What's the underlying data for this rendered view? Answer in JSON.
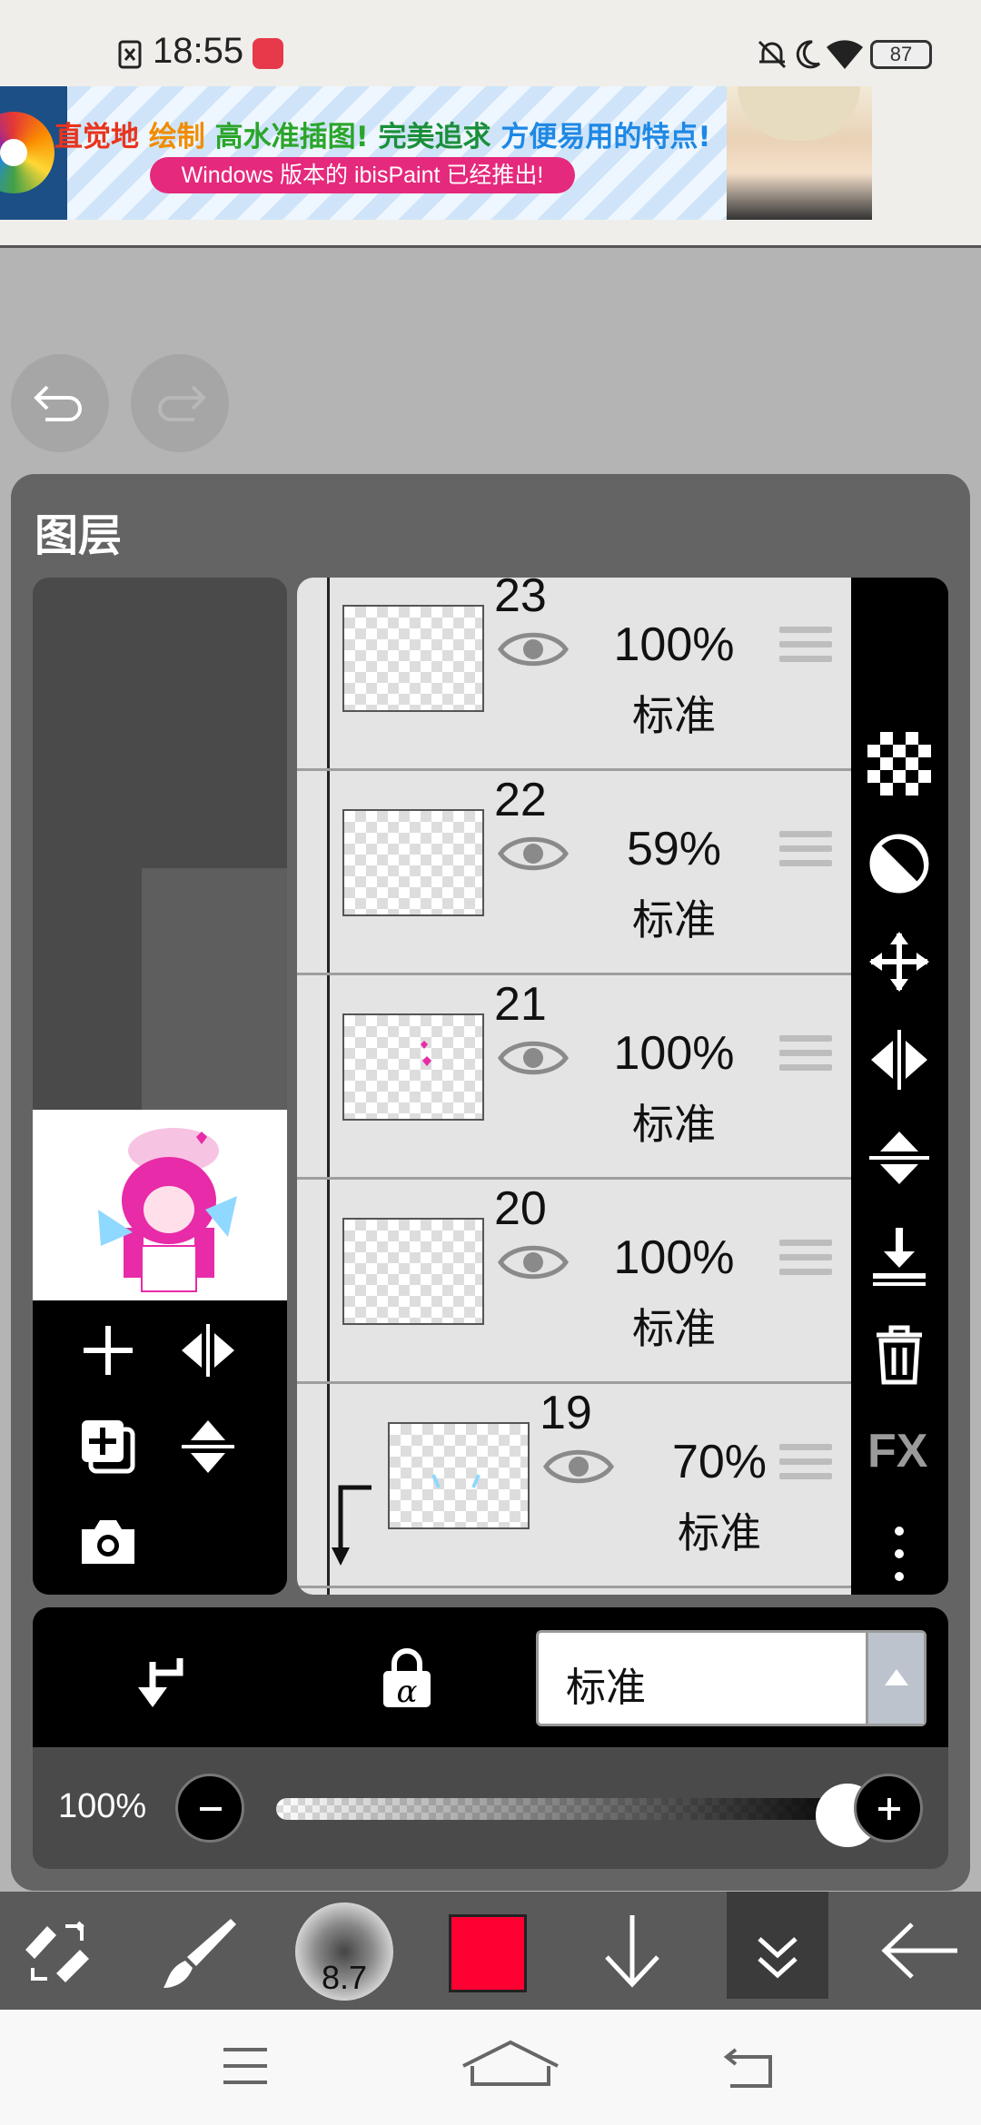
{
  "status_bar": {
    "time": "18:55",
    "battery": "87"
  },
  "ad": {
    "headline_parts": [
      {
        "text": "直觉地 ",
        "color": "#e8341c"
      },
      {
        "text": "绘制 ",
        "color": "#f08c00"
      },
      {
        "text": "高水准插图! ",
        "color": "#2aa52a"
      },
      {
        "text": "完美追求 ",
        "color": "#1a8f3a"
      },
      {
        "text": "方便易用的特点!",
        "color": "#1e88e5"
      }
    ],
    "button": "Windows 版本的 ibisPaint 已经推出!"
  },
  "panel": {
    "title": "图层"
  },
  "layers": [
    {
      "number": "23",
      "opacity": "100%",
      "blend": "标准"
    },
    {
      "number": "22",
      "opacity": "59%",
      "blend": "标准"
    },
    {
      "number": "21",
      "opacity": "100%",
      "blend": "标准"
    },
    {
      "number": "20",
      "opacity": "100%",
      "blend": "标准"
    },
    {
      "number": "19",
      "opacity": "70%",
      "blend": "标准"
    }
  ],
  "right_tools": {
    "fx": "FX"
  },
  "blend_mode": {
    "selected": "标准"
  },
  "opacity": {
    "label": "100%",
    "value": 1.0
  },
  "toolbar": {
    "brush_size": "8.7",
    "color": "#ff0033"
  }
}
